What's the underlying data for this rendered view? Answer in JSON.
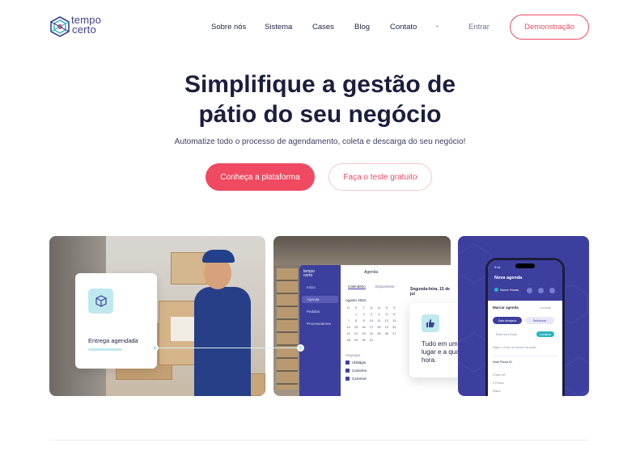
{
  "header": {
    "logo_line1": "tempo",
    "logo_line2": "certo",
    "nav": [
      "Sobre nós",
      "Sistema",
      "Cases",
      "Blog",
      "Contato"
    ],
    "login": "Entrar",
    "demo_button": "Demonstração"
  },
  "hero": {
    "title_line1": "Simplifique a gestão de",
    "title_line2": "pátio do seu negócio",
    "subtitle": "Automatize todo o processo de agendamento, coleta e descarga do seu negócio!",
    "primary_button": "Conheça a plataforma",
    "secondary_button": "Faça o teste gratuito"
  },
  "panel1": {
    "card_label": "Entrega agendada",
    "icon": "package-icon"
  },
  "panel2": {
    "app": {
      "logo_line1": "tempo",
      "logo_line2": "certo",
      "top_title": "Agenda",
      "sidebar": [
        "Início",
        "Agenda",
        "Pedidos",
        "Processadores"
      ],
      "tabs": [
        "Calendário",
        "Disponíveis"
      ],
      "date": "Segunda-feira, 15 de jul",
      "month": "Agosto 2024",
      "calendar_days": [
        "D",
        "S",
        "T",
        "Q",
        "Q",
        "S",
        "S",
        "",
        "1",
        "2",
        "3",
        "4",
        "5",
        "6",
        "7",
        "8",
        "9",
        "10",
        "11",
        "12",
        "13",
        "14",
        "15",
        "16",
        "17",
        "18",
        "19",
        "20",
        "21",
        "22",
        "23",
        "24",
        "25",
        "26",
        "27",
        "28",
        "29",
        "30",
        "31",
        "",
        "",
        ""
      ],
      "filter_label": "Segregar",
      "checks": [
        "Utilitágio",
        "Caminha",
        "Carretral"
      ]
    },
    "card_text": "Tudo em um único lugar e a qualquer hora.",
    "icon": "thumbs-up-icon"
  },
  "panel3": {
    "phone": {
      "time": "9:41",
      "title": "Nova agenda",
      "step1": "Nome Hozas",
      "section": "Marcar agenda",
      "section_right": "Consulta",
      "pill1": "Data desejada",
      "pill2": "Selecionar",
      "search": "Entre uma Rcuth",
      "search_btn": "Localizar",
      "hint": "Digite o nome ou número da placa",
      "row_label": "Note Fiscal ID",
      "rows": [
        "Chave NF",
        "# Pedido",
        "Status"
      ]
    }
  },
  "colors": {
    "accent": "#ef4a62",
    "brand": "#3d3f9e",
    "teal": "#bfe9ee"
  }
}
